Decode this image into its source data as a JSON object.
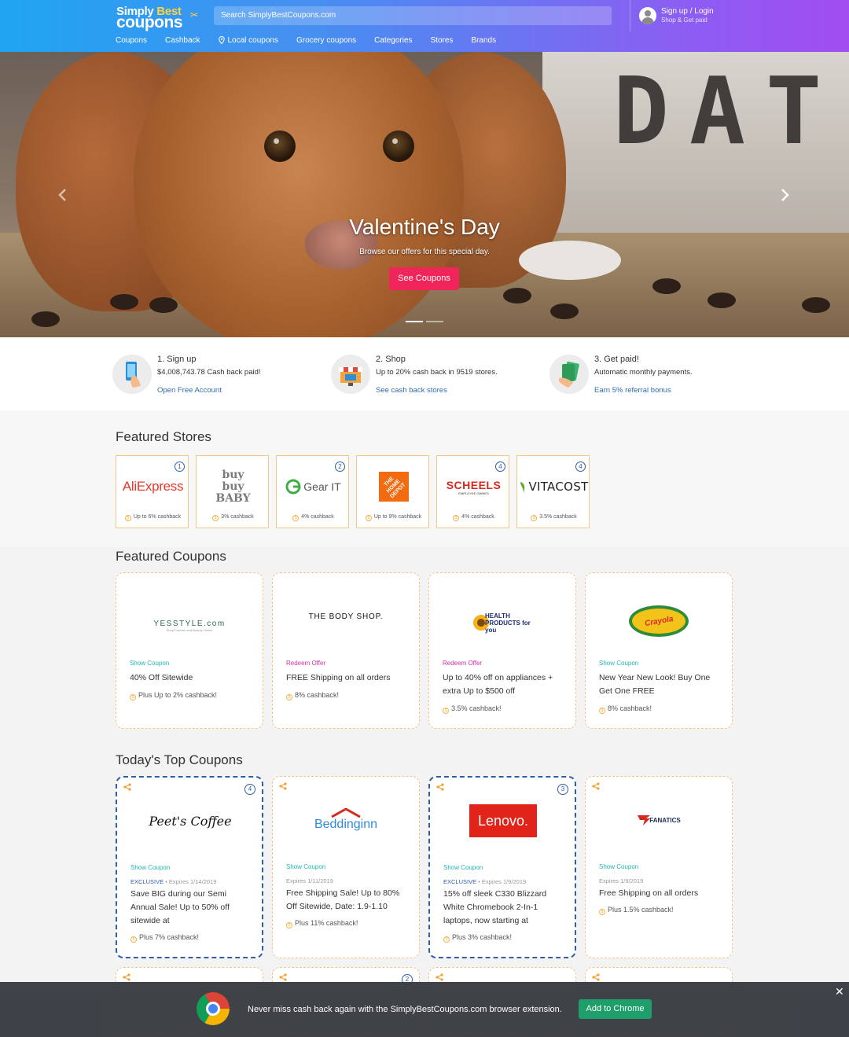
{
  "header": {
    "logo_top": "Simply",
    "logo_top_accent": "Best",
    "logo_bottom": "coupons",
    "search_placeholder": "Search SimplyBestCoupons.com",
    "signup": "Sign up / Login",
    "signup_sub": "Shop & Get paid",
    "nav": [
      "Coupons",
      "Cashback",
      "Local coupons",
      "Grocery coupons",
      "Categories",
      "Stores",
      "Brands"
    ]
  },
  "hero": {
    "backdrop_text": "DATE",
    "title": "Valentine's Day",
    "subtitle": "Browse our offers for this special day.",
    "button": "See Coupons"
  },
  "steps": [
    {
      "title": "1. Sign up",
      "sub": "$4,008,743.78 Cash back paid!",
      "link": "Open Free Account"
    },
    {
      "title": "2. Shop",
      "sub": "Up to 20% cash back in 9519 stores.",
      "link": "See cash back stores"
    },
    {
      "title": "3. Get paid!",
      "sub": "Automatic monthly payments.",
      "link": "Earn 5% referral bonus"
    }
  ],
  "featured_stores": {
    "title": "Featured Stores",
    "items": [
      {
        "name": "AliExpress",
        "num": "1",
        "cashback": "Up to 6% cashback"
      },
      {
        "name": "buy buy BABY",
        "num": "",
        "cashback": "3% cashback"
      },
      {
        "name": "Gear IT",
        "num": "2",
        "cashback": "4% cashback"
      },
      {
        "name": "THE HOME DEPOT",
        "num": "",
        "cashback": "Up to 9% cashback"
      },
      {
        "name": "SCHEELS",
        "sub": "EMPLOYEE OWNED",
        "num": "4",
        "cashback": "4% cashback"
      },
      {
        "name": "VITACOST",
        "num": "4",
        "cashback": "3.5% cashback"
      }
    ]
  },
  "featured_coupons": {
    "title": "Featured Coupons",
    "items": [
      {
        "brand": "YESSTYLE.com",
        "brand_sub": "Shop Fashion and Beauty Online",
        "action": "Show Coupon",
        "desc": "40% Off Sitewide",
        "cashback": "Plus Up to 2% cashback!"
      },
      {
        "brand": "THE BODY SHOP.",
        "action": "Redeem Offer",
        "desc": "FREE Shipping on all orders",
        "cashback": "8% cashback!"
      },
      {
        "brand": "HEALTH PRODUCTS for you",
        "action": "Redeem Offer",
        "desc": "Up to 40% off on appliances + extra Up to $500 off",
        "cashback": "3.5% cashback!"
      },
      {
        "brand": "Crayola",
        "action": "Show Coupon",
        "desc": "New Year New Look! Buy One Get One FREE",
        "cashback": "8% cashback!"
      }
    ]
  },
  "top_coupons": {
    "title": "Today's Top Coupons",
    "items": [
      {
        "brand": "Peet's Coffee",
        "num": "4",
        "action": "Show Coupon",
        "exclusive": "EXCLUSIVE",
        "expires": "Expires 1/14/2019",
        "desc": "Save BIG during our Semi Annual Sale! Up to 50% off sitewide at",
        "cashback": "Plus 7% cashback!"
      },
      {
        "brand": "Beddinginn",
        "num": "",
        "action": "Show Coupon",
        "exclusive": "",
        "expires": "Expires 1/11/2019",
        "desc": "Free Shipping Sale! Up to 80% Off Sitewide, Date: 1.9-1.10",
        "cashback": "Plus 11% cashback!"
      },
      {
        "brand": "Lenovo.",
        "num": "3",
        "action": "Show Coupon",
        "exclusive": "EXCLUSIVE",
        "expires": "Expires 1/9/2019",
        "desc": "15% off sleek C330 Blizzard White Chromebook 2-In-1 laptops, now starting at",
        "cashback": "Plus 3% cashback!"
      },
      {
        "brand": "FANATICS",
        "num": "",
        "action": "Show Coupon",
        "exclusive": "",
        "expires": "Expires 1/9/2019",
        "desc": "Free Shipping on all orders",
        "cashback": "Plus 1.5% cashback!"
      }
    ]
  },
  "next_row_nums": [
    "",
    "2",
    "",
    ""
  ],
  "extension_bar": {
    "text": "Never miss cash back again with the SimplyBestCoupons.com browser extension.",
    "button": "Add to Chrome",
    "close": "✕"
  },
  "colors": {
    "header_gradient_start": "#1fa5f2",
    "header_gradient_end": "#a24df0",
    "hero_button": "#f0265a",
    "link_blue": "#2f6bb7",
    "show_coupon": "#21b8b0",
    "redeem_offer": "#d52fa8",
    "add_to_chrome": "#1e9e6a"
  }
}
